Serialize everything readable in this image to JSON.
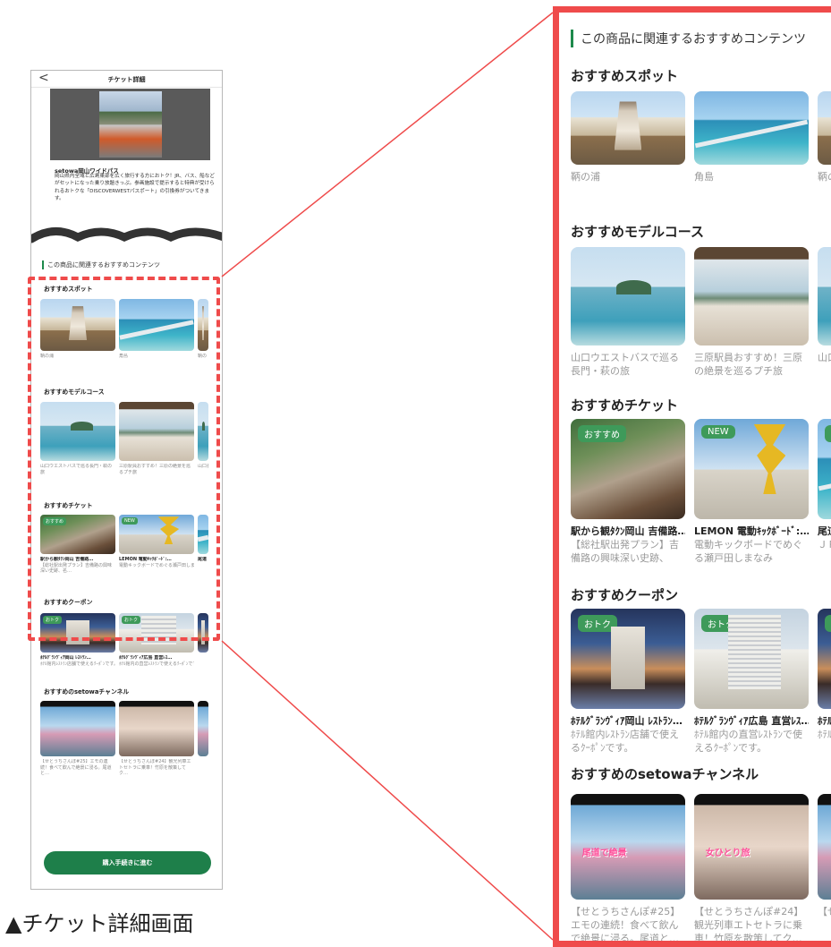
{
  "phone": {
    "back_glyph": "<",
    "header_title": "チケット詳細",
    "product_name": "setowa岡山ワイドパス",
    "product_desc": "岡山県内全域と広島東部を広く旅行する方におトク！JR、バス、船などがセットになった乗り放題きっぷ。参画施設で提示すると特典が受けられるおトクな「DISCOVERWESTパスポート」の引換券がついてきます。",
    "related_title": "この商品に関連するおすすめコンテンツ",
    "sections": {
      "spot": {
        "title": "おすすめスポット",
        "cards": [
          {
            "caption": "鞆の浦"
          },
          {
            "caption": "角島"
          },
          {
            "caption": "鞆の"
          }
        ]
      },
      "course": {
        "title": "おすすめモデルコース",
        "cards": [
          {
            "caption": "山口ウエストバスで巡る長門・萩の旅"
          },
          {
            "caption": "三原駅員おすすめ！三原の絶景を巡るプチ旅"
          },
          {
            "caption": "山口長門"
          }
        ]
      },
      "ticket": {
        "title": "おすすめチケット",
        "cards": [
          {
            "badge": "おすすめ",
            "name": "駅から観ﾀｸﾝ岡山 吉備路…",
            "caption": "【総社駅出発プラン】吉備路の興味深い史跡、名…"
          },
          {
            "badge": "NEW",
            "name": "LEMON 電動ｷｯｸﾎﾞｰﾄﾞ:…",
            "caption": "電動キックボードでめぐる瀬戸田しまなみ"
          },
          {
            "badge": "お",
            "name": "尾道",
            "caption": "ＪＲタク"
          }
        ]
      },
      "coupon": {
        "title": "おすすめクーポン",
        "cards": [
          {
            "badge": "おトク",
            "name": "ﾎﾃﾙｸﾞﾗﾝｳﾞｨｱ岡山 ﾚｽﾄﾗﾝ…",
            "caption": "ﾎﾃﾙ館内ﾚｽﾄﾗﾝ店舗で使えるｸｰﾎﾟﾝです。"
          },
          {
            "badge": "おトク",
            "name": "ﾎﾃﾙｸﾞﾗﾝｳﾞｨｱ広島 直営ﾚｽ…",
            "caption": "ﾎﾃﾙ館内の直営ﾚｽﾄﾗﾝで使えるｸｰﾎﾟﾝです。"
          },
          {
            "badge": "お",
            "name": "ﾎﾃﾙｸﾞ",
            "caption": "ﾎﾃﾙ館るｸｰ"
          }
        ]
      },
      "channel": {
        "title": "おすすめのsetowaチャンネル",
        "cards": [
          {
            "overlay": "尾道で絶景",
            "caption": "【せとうちさんぽ#25】エモの連続！食べて飲んで絶景に浸る。尾道と…"
          },
          {
            "overlay": "女ひとり旅",
            "caption": "【せとうちさんぽ#24】観光列車エトセトラに乗車！竹原を散策してク…"
          },
          {
            "overlay": "",
            "caption": "【せクルー"
          }
        ]
      }
    },
    "buy_button": "購入手続きに進む"
  },
  "caption": "▲チケット詳細画面",
  "colors": {
    "accent_green": "#1e7f4a",
    "highlight_red": "#ef4b4b"
  }
}
